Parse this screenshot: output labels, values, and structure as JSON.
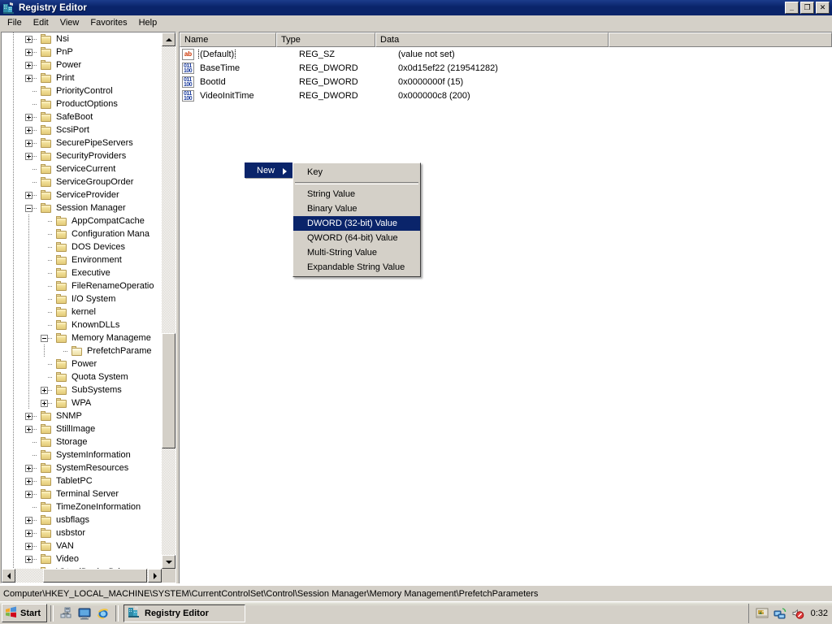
{
  "window": {
    "title": "Registry Editor",
    "icon": "registry-editor-icon",
    "buttons": {
      "minimize": "_",
      "maximize": "❐",
      "close": "✕"
    }
  },
  "menubar": {
    "items": [
      "File",
      "Edit",
      "View",
      "Favorites",
      "Help"
    ]
  },
  "tree": {
    "nodes": [
      {
        "label": "Nsi",
        "indent": 2,
        "expander": "plus"
      },
      {
        "label": "PnP",
        "indent": 2,
        "expander": "plus"
      },
      {
        "label": "Power",
        "indent": 2,
        "expander": "plus"
      },
      {
        "label": "Print",
        "indent": 2,
        "expander": "plus"
      },
      {
        "label": "PriorityControl",
        "indent": 2,
        "expander": "none"
      },
      {
        "label": "ProductOptions",
        "indent": 2,
        "expander": "none"
      },
      {
        "label": "SafeBoot",
        "indent": 2,
        "expander": "plus"
      },
      {
        "label": "ScsiPort",
        "indent": 2,
        "expander": "plus"
      },
      {
        "label": "SecurePipeServers",
        "indent": 2,
        "expander": "plus"
      },
      {
        "label": "SecurityProviders",
        "indent": 2,
        "expander": "plus"
      },
      {
        "label": "ServiceCurrent",
        "indent": 2,
        "expander": "none"
      },
      {
        "label": "ServiceGroupOrder",
        "indent": 2,
        "expander": "none"
      },
      {
        "label": "ServiceProvider",
        "indent": 2,
        "expander": "plus"
      },
      {
        "label": "Session Manager",
        "indent": 2,
        "expander": "minus"
      },
      {
        "label": "AppCompatCache",
        "indent": 3,
        "expander": "none"
      },
      {
        "label": "Configuration Mana",
        "indent": 3,
        "expander": "none"
      },
      {
        "label": "DOS Devices",
        "indent": 3,
        "expander": "none"
      },
      {
        "label": "Environment",
        "indent": 3,
        "expander": "none"
      },
      {
        "label": "Executive",
        "indent": 3,
        "expander": "none"
      },
      {
        "label": "FileRenameOperatio",
        "indent": 3,
        "expander": "none"
      },
      {
        "label": "I/O System",
        "indent": 3,
        "expander": "none"
      },
      {
        "label": "kernel",
        "indent": 3,
        "expander": "none"
      },
      {
        "label": "KnownDLLs",
        "indent": 3,
        "expander": "none"
      },
      {
        "label": "Memory Manageme",
        "indent": 3,
        "expander": "minus"
      },
      {
        "label": "PrefetchParame",
        "indent": 4,
        "expander": "none",
        "selected": true
      },
      {
        "label": "Power",
        "indent": 3,
        "expander": "none"
      },
      {
        "label": "Quota System",
        "indent": 3,
        "expander": "none"
      },
      {
        "label": "SubSystems",
        "indent": 3,
        "expander": "plus"
      },
      {
        "label": "WPA",
        "indent": 3,
        "expander": "plus"
      },
      {
        "label": "SNMP",
        "indent": 2,
        "expander": "plus"
      },
      {
        "label": "StillImage",
        "indent": 2,
        "expander": "plus"
      },
      {
        "label": "Storage",
        "indent": 2,
        "expander": "none"
      },
      {
        "label": "SystemInformation",
        "indent": 2,
        "expander": "none"
      },
      {
        "label": "SystemResources",
        "indent": 2,
        "expander": "plus"
      },
      {
        "label": "TabletPC",
        "indent": 2,
        "expander": "plus"
      },
      {
        "label": "Terminal Server",
        "indent": 2,
        "expander": "plus"
      },
      {
        "label": "TimeZoneInformation",
        "indent": 2,
        "expander": "none"
      },
      {
        "label": "usbflags",
        "indent": 2,
        "expander": "plus"
      },
      {
        "label": "usbstor",
        "indent": 2,
        "expander": "plus"
      },
      {
        "label": "VAN",
        "indent": 2,
        "expander": "plus"
      },
      {
        "label": "Video",
        "indent": 2,
        "expander": "plus"
      },
      {
        "label": "VirtualDeviceDriv",
        "indent": 2,
        "expander": "plus"
      }
    ]
  },
  "list": {
    "columns": [
      "Name",
      "Type",
      "Data"
    ],
    "rows": [
      {
        "name": "(Default)",
        "type": "REG_SZ",
        "data": "(value not set)",
        "icon": "string-value-icon",
        "focused": true
      },
      {
        "name": "BaseTime",
        "type": "REG_DWORD",
        "data": "0x0d15ef22 (219541282)",
        "icon": "dword-value-icon",
        "focused": false
      },
      {
        "name": "BootId",
        "type": "REG_DWORD",
        "data": "0x0000000f (15)",
        "icon": "dword-value-icon",
        "focused": false
      },
      {
        "name": "VideoInitTime",
        "type": "REG_DWORD",
        "data": "0x000000c8 (200)",
        "icon": "dword-value-icon",
        "focused": false
      }
    ]
  },
  "context_menu": {
    "parent_label": "New",
    "items": [
      {
        "label": "Key",
        "highlighted": false
      },
      {
        "separator": true
      },
      {
        "label": "String Value",
        "highlighted": false
      },
      {
        "label": "Binary Value",
        "highlighted": false
      },
      {
        "label": "DWORD (32-bit) Value",
        "highlighted": true
      },
      {
        "label": "QWORD (64-bit) Value",
        "highlighted": false
      },
      {
        "label": "Multi-String Value",
        "highlighted": false
      },
      {
        "label": "Expandable String Value",
        "highlighted": false
      }
    ]
  },
  "statusbar": {
    "path": "Computer\\HKEY_LOCAL_MACHINE\\SYSTEM\\CurrentControlSet\\Control\\Session Manager\\Memory Management\\PrefetchParameters"
  },
  "taskbar": {
    "start_label": "Start",
    "quick_launch": [
      "network-icon",
      "show-desktop-icon",
      "internet-explorer-icon"
    ],
    "tasks": [
      {
        "label": "Registry Editor",
        "icon": "registry-editor-icon",
        "active": true
      }
    ],
    "tray_icons": [
      "display-settings-icon",
      "network-connection-icon",
      "volume-muted-icon"
    ],
    "clock": "0:32"
  },
  "colors": {
    "titlebar": "#0a246a",
    "face": "#d4d0c8",
    "highlight": "#0a246a",
    "window": "#ffffff",
    "folder": "#f0dd95"
  }
}
